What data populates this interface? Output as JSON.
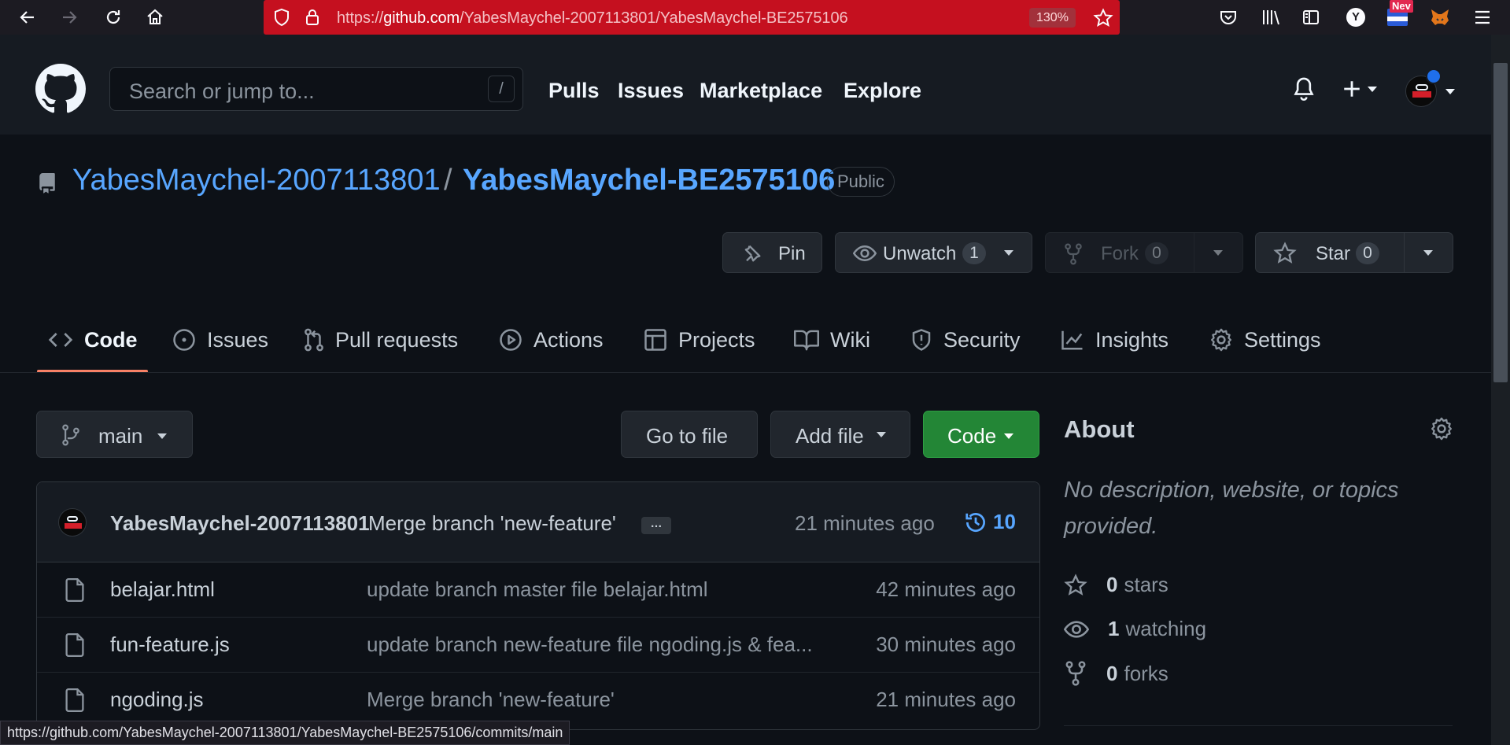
{
  "browser": {
    "url_prefix": "https://",
    "url_domain": "github.com",
    "url_path": "/YabesMaychel-2007113801/YabesMaychel-BE2575106",
    "zoom": "130%",
    "new_badge": "Nev",
    "profile_letter": "Y"
  },
  "header": {
    "search_placeholder": "Search or jump to...",
    "search_key": "/",
    "nav": [
      "Pulls",
      "Issues",
      "Marketplace",
      "Explore"
    ]
  },
  "repo": {
    "owner": "YabesMaychel-2007113801",
    "separator": "/",
    "name": "YabesMaychel-BE2575106",
    "visibility": "Public",
    "actions": {
      "pin": "Pin",
      "unwatch": "Unwatch",
      "watch_count": "1",
      "fork": "Fork",
      "fork_count": "0",
      "star": "Star",
      "star_count": "0"
    }
  },
  "tabs": [
    "Code",
    "Issues",
    "Pull requests",
    "Actions",
    "Projects",
    "Wiki",
    "Security",
    "Insights",
    "Settings"
  ],
  "toolbar": {
    "branch": "main",
    "go_to_file": "Go to file",
    "add_file": "Add file",
    "code": "Code"
  },
  "commit": {
    "author": "YabesMaychel-2007113801",
    "message": "Merge branch 'new-feature'",
    "more": "…",
    "time": "21 minutes ago",
    "count": "10"
  },
  "files": [
    {
      "name": "belajar.html",
      "message": "update branch master file belajar.html",
      "time": "42 minutes ago"
    },
    {
      "name": "fun-feature.js",
      "message": "update branch new-feature file ngoding.js & fea...",
      "time": "30 minutes ago"
    },
    {
      "name": "ngoding.js",
      "message": "Merge branch 'new-feature'",
      "time": "21 minutes ago"
    }
  ],
  "about": {
    "title": "About",
    "description": "No description, website, or topics provided.",
    "stars_count": "0",
    "stars_label": "stars",
    "watching_count": "1",
    "watching_label": "watching",
    "forks_count": "0",
    "forks_label": "forks"
  },
  "status_url": "https://github.com/YabesMaychel-2007113801/YabesMaychel-BE2575106/commits/main",
  "colors": {
    "link_blue": "#58a6ff",
    "code_green": "#238636",
    "tab_accent": "#f78166",
    "url_bar_red": "#c5101f"
  }
}
